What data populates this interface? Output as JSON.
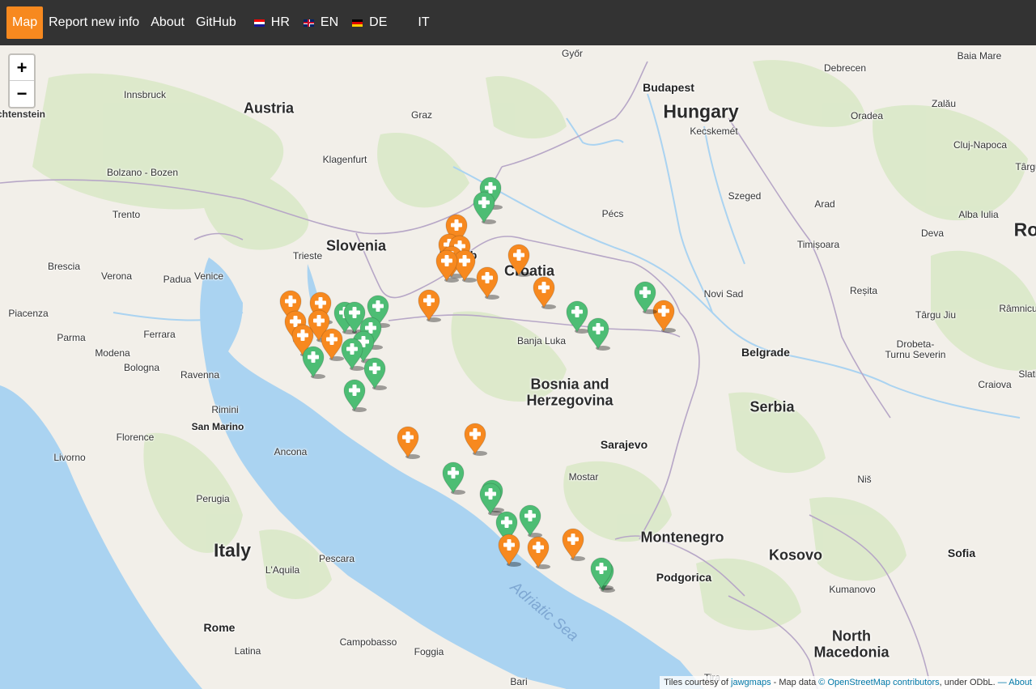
{
  "nav": {
    "map": "Map",
    "report": "Report new info",
    "about": "About",
    "github": "GitHub",
    "languages": [
      {
        "code": "HR",
        "flag": "croatia-flag-icon"
      },
      {
        "code": "EN",
        "flag": "uk-flag-icon"
      },
      {
        "code": "DE",
        "flag": "germany-flag-icon"
      },
      {
        "code": "IT",
        "flag": "italy-flag-icon"
      }
    ],
    "active_color": "#f7891f"
  },
  "zoom": {
    "in": "+",
    "out": "−"
  },
  "colors": {
    "orange_marker": "#f7891f",
    "green_marker": "#4dbd74",
    "sea": "#aad3f1",
    "land": "#f2efe9",
    "forest": "#d8e8c8"
  },
  "labels": {
    "countries": {
      "austria": "Austria",
      "hungary": "Hungary",
      "slovenia": "Slovenia",
      "croatia": "Croatia",
      "bosnia": "Bosnia and",
      "bosnia2": "Herzegovina",
      "serbia": "Serbia",
      "italy": "Italy",
      "montenegro": "Montenegro",
      "kosovo": "Kosovo",
      "north_macedonia": "North",
      "north_macedonia2": "Macedonia",
      "liechtenstein": "chtenstein",
      "ro": "Ro"
    },
    "capitals": {
      "budapest": "Budapest",
      "zagreb": "Zagreb",
      "belgrade": "Belgrade",
      "sarajevo": "Sarajevo",
      "rome": "Rome",
      "podgorica": "Podgorica",
      "sofia": "Sofia",
      "san_marino": "San Marino"
    },
    "cities": {
      "gyor": "Győr",
      "baia_mare": "Baia Mare",
      "debrecen": "Debrecen",
      "innsbruck": "Innsbruck",
      "graz": "Graz",
      "kecskemet": "Kecskemét",
      "oradea": "Oradea",
      "zalau": "Zalău",
      "cluj": "Cluj-Napoca",
      "klagenfurt": "Klagenfurt",
      "bolzano": "Bolzano - Bozen",
      "targu": "Târgu",
      "trento": "Trento",
      "szeged": "Szeged",
      "arad": "Arad",
      "pecs": "Pécs",
      "alba": "Alba Iulia",
      "deva": "Deva",
      "timisoara": "Timișoara",
      "brescia": "Brescia",
      "verona": "Verona",
      "padua": "Padua",
      "venice": "Venice",
      "trieste": "Trieste",
      "novi_sad": "Novi Sad",
      "resita": "Reșita",
      "targu_jiu": "Târgu Jiu",
      "ramnicu": "Râmnicu",
      "piacenza": "Piacenza",
      "parma": "Parma",
      "ferrara": "Ferrara",
      "banja_luka": "Banja Luka",
      "drobeta": "Drobeta-",
      "drobeta2": "Turnu Severin",
      "modena": "Modena",
      "bologna": "Bologna",
      "ravenna": "Ravenna",
      "craiova": "Craiova",
      "slati": "Slati",
      "rimini": "Rimini",
      "florence": "Florence",
      "ancona": "Ancona",
      "livorno": "Livorno",
      "perugia": "Perugia",
      "mostar": "Mostar",
      "nis": "Niš",
      "pescara": "Pescara",
      "laquila": "L'Aquila",
      "kumanovo": "Kumanovo",
      "latina": "Latina",
      "campobasso": "Campobasso",
      "foggia": "Foggia",
      "bari": "Bari",
      "tirana": "Tira"
    },
    "sea": "Adriatic Sea"
  },
  "markers": [
    {
      "color": "green"
    },
    {
      "color": "green"
    },
    {
      "color": "orange"
    },
    {
      "color": "orange"
    },
    {
      "color": "orange"
    },
    {
      "color": "orange"
    },
    {
      "color": "orange"
    },
    {
      "color": "orange"
    },
    {
      "color": "orange"
    },
    {
      "color": "orange"
    },
    {
      "color": "orange"
    },
    {
      "color": "orange"
    },
    {
      "color": "orange"
    },
    {
      "color": "orange"
    },
    {
      "color": "orange"
    },
    {
      "color": "orange"
    },
    {
      "color": "orange"
    },
    {
      "color": "orange"
    },
    {
      "color": "orange"
    },
    {
      "color": "green"
    },
    {
      "color": "green"
    },
    {
      "color": "green"
    },
    {
      "color": "green"
    },
    {
      "color": "green"
    },
    {
      "color": "green"
    },
    {
      "color": "green"
    },
    {
      "color": "green"
    },
    {
      "color": "green"
    },
    {
      "color": "green"
    },
    {
      "color": "green"
    },
    {
      "color": "green"
    },
    {
      "color": "orange"
    },
    {
      "color": "orange"
    },
    {
      "color": "green"
    },
    {
      "color": "green"
    },
    {
      "color": "green"
    },
    {
      "color": "green"
    },
    {
      "color": "green"
    },
    {
      "color": "orange"
    },
    {
      "color": "orange"
    },
    {
      "color": "orange"
    },
    {
      "color": "green"
    },
    {
      "color": "green"
    }
  ],
  "attribution": {
    "prefix": "Tiles courtesy of",
    "jawg": "jawgmaps",
    "mid": "- Map data",
    "osm": "© OpenStreetMap contributors",
    "suffix": ", under ODbL.",
    "about": "— About"
  }
}
